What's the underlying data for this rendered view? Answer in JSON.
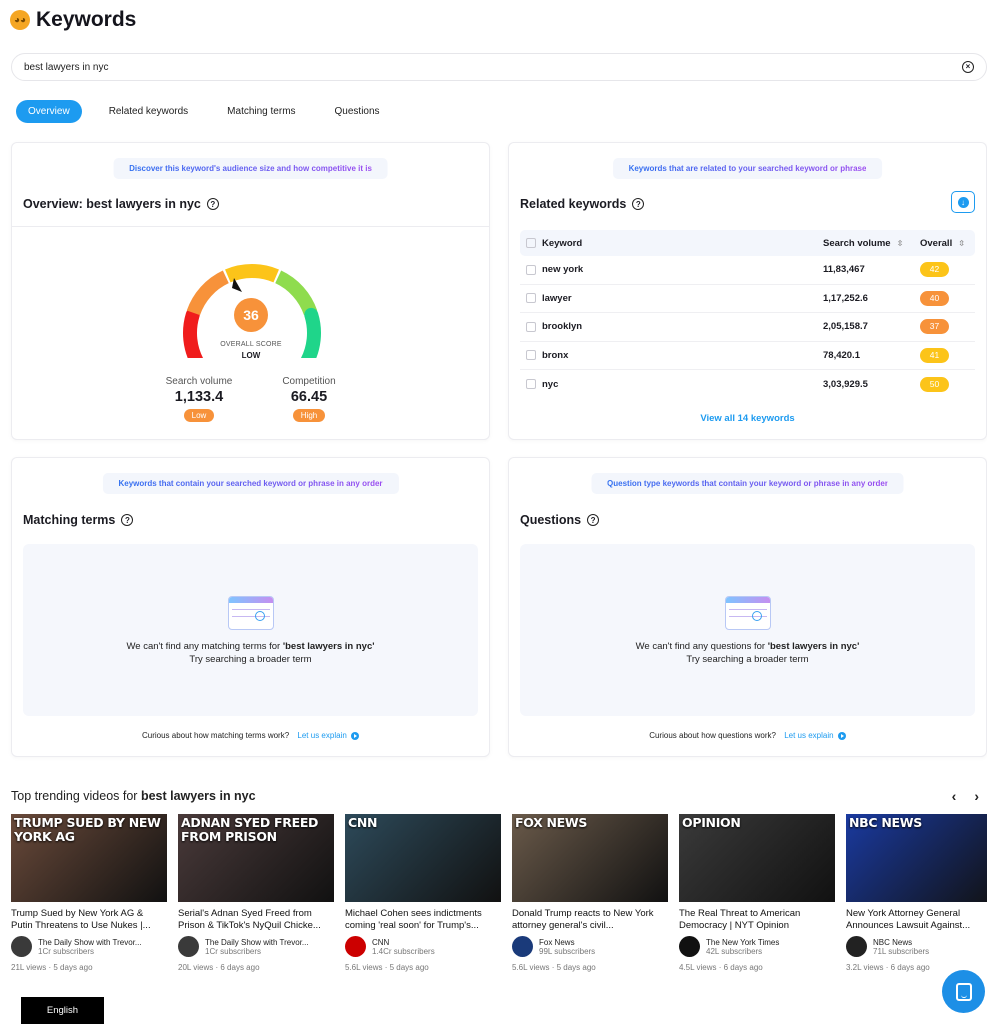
{
  "header": {
    "title": "Keywords",
    "logo_icon": "nerd-face-emoji"
  },
  "search": {
    "value": "best lawyers in nyc",
    "placeholder": ""
  },
  "tabs": [
    {
      "label": "Overview",
      "active": true
    },
    {
      "label": "Related keywords",
      "active": false
    },
    {
      "label": "Matching terms",
      "active": false
    },
    {
      "label": "Questions",
      "active": false
    }
  ],
  "overview": {
    "hint": "Discover this keyword's audience size and how competitive it is",
    "title": "Overview: best lawyers in nyc",
    "score": "36",
    "score_fraction": 0.36,
    "score_label": "OVERALL SCORE",
    "score_rating": "LOW",
    "gauge_colors": [
      "#f01c1c",
      "#f7923a",
      "#fcc419",
      "#8fdc4e",
      "#1fd58a"
    ],
    "search_volume": {
      "label": "Search volume",
      "value": "1,133.4",
      "badge": "Low"
    },
    "competition": {
      "label": "Competition",
      "value": "66.45",
      "badge": "High"
    }
  },
  "related": {
    "hint": "Keywords that are related to your searched keyword or phrase",
    "title": "Related keywords",
    "columns": [
      "Keyword",
      "Search volume",
      "Overall"
    ],
    "rows": [
      {
        "keyword": "new york",
        "volume": "11,83,467",
        "overall": "42",
        "color": "#fcc419"
      },
      {
        "keyword": "lawyer",
        "volume": "1,17,252.6",
        "overall": "40",
        "color": "#f7923a"
      },
      {
        "keyword": "brooklyn",
        "volume": "2,05,158.7",
        "overall": "37",
        "color": "#f7923a"
      },
      {
        "keyword": "bronx",
        "volume": "78,420.1",
        "overall": "41",
        "color": "#fcc419"
      },
      {
        "keyword": "nyc",
        "volume": "3,03,929.5",
        "overall": "50",
        "color": "#fcc419"
      }
    ],
    "view_all": "View all 14 keywords"
  },
  "matching": {
    "hint": "Keywords that contain your searched keyword or phrase in any order",
    "title": "Matching terms",
    "empty_prefix": "We can't find any matching terms for ",
    "empty_term": "'best lawyers in nyc'",
    "empty_sub": "Try searching a broader term",
    "explain_text": "Curious about how matching terms work?",
    "explain_link": "Let us explain"
  },
  "questions": {
    "hint": "Question type keywords that contain your keyword or phrase in any order",
    "title": "Questions",
    "empty_prefix": "We can't find any questions for ",
    "empty_term": "'best lawyers in nyc'",
    "empty_sub": "Try searching a broader term",
    "explain_text": "Curious about how questions work?",
    "explain_link": "Let us explain"
  },
  "trending": {
    "title_prefix": "Top trending videos for ",
    "title_term": "best lawyers in nyc",
    "videos": [
      {
        "thumb_text": "TRUMP SUED BY NEW YORK AG",
        "title": "Trump Sued by New York AG & Putin Threatens to Use Nukes |...",
        "channel": "The Daily Show with Trevor...",
        "subs": "1Cr subscribers",
        "meta": "21L views · 5 days ago",
        "avatar_color": "#3a3a3a",
        "thumb_color": "#6a4a3a"
      },
      {
        "thumb_text": "ADNAN SYED FREED FROM PRISON",
        "title": "Serial's Adnan Syed Freed from Prison & TikTok's NyQuil Chicke...",
        "channel": "The Daily Show with Trevor...",
        "subs": "1Cr subscribers",
        "meta": "20L views · 6 days ago",
        "avatar_color": "#3a3a3a",
        "thumb_color": "#4a3a3a"
      },
      {
        "thumb_text": "CNN",
        "title": "Michael Cohen sees indictments coming 'real soon' for Trump's...",
        "channel": "CNN",
        "subs": "1.4Cr subscribers",
        "meta": "5.6L views · 5 days ago",
        "avatar_color": "#cc0000",
        "thumb_color": "#2d4a5a"
      },
      {
        "thumb_text": "FOX NEWS",
        "title": "Donald Trump reacts to New York attorney general's civil...",
        "channel": "Fox News",
        "subs": "99L subscribers",
        "meta": "5.6L views · 5 days ago",
        "avatar_color": "#1a3a7a",
        "thumb_color": "#6a5a4a"
      },
      {
        "thumb_text": "OPINION",
        "title": "The Real Threat to American Democracy | NYT Opinion",
        "channel": "The New York Times",
        "subs": "42L subscribers",
        "meta": "4.5L views · 6 days ago",
        "avatar_color": "#111111",
        "thumb_color": "#3a3a3a"
      },
      {
        "thumb_text": "NBC NEWS",
        "title": "New York Attorney General Announces Lawsuit Against...",
        "channel": "NBC News",
        "subs": "71L subscribers",
        "meta": "3.2L views · 6 days ago",
        "avatar_color": "#222222",
        "thumb_color": "#1a3aa0"
      }
    ]
  },
  "footer": {
    "language": "English",
    "chat_icon": "chat-bubble-icon"
  }
}
